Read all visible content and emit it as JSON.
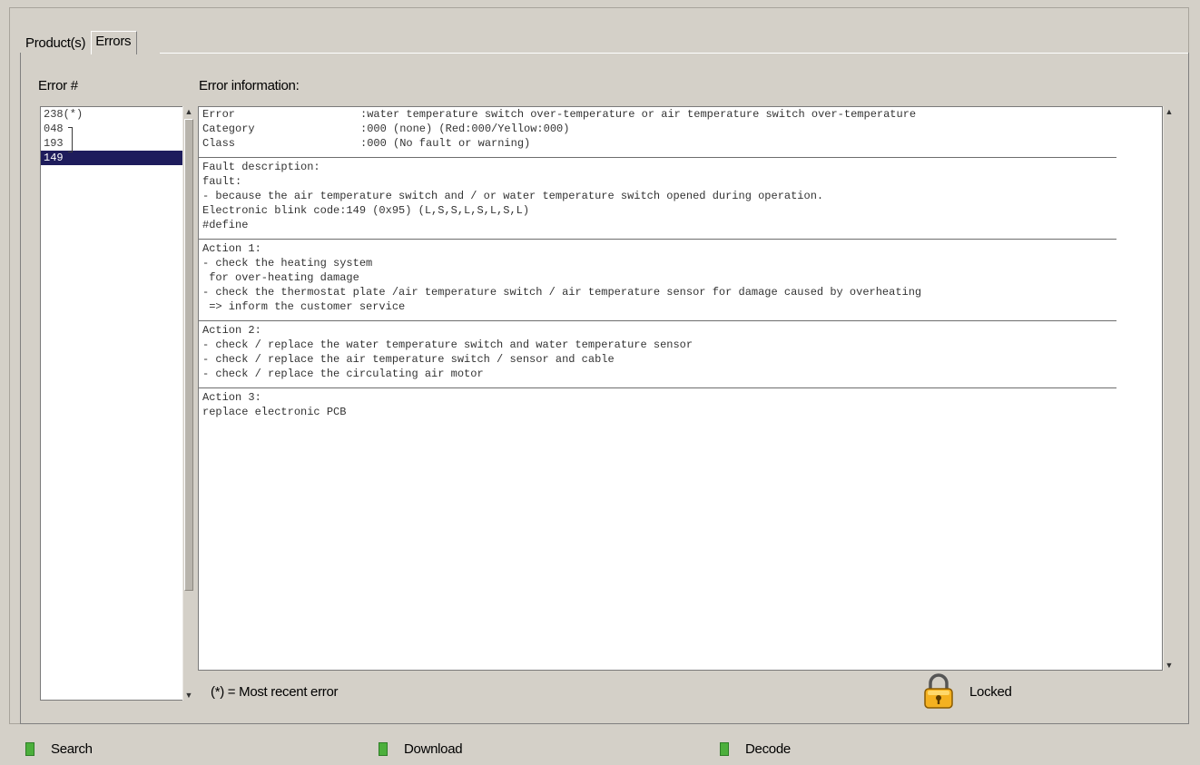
{
  "tabs": [
    {
      "label": "Product(s)",
      "active": false
    },
    {
      "label": "Errors",
      "active": true
    }
  ],
  "error_list": {
    "header": "Error #",
    "items": [
      {
        "code": "238(*)",
        "selected": false
      },
      {
        "code": "048",
        "selected": false
      },
      {
        "code": "193",
        "selected": false
      },
      {
        "code": "149",
        "selected": true
      }
    ]
  },
  "error_info": {
    "header": "Error information:",
    "fields": [
      {
        "key": "Error",
        "value": ":water temperature switch over-temperature or air temperature switch over-temperature"
      },
      {
        "key": "Category",
        "value": ":000 (none) (Red:000/Yellow:000)"
      },
      {
        "key": "Class",
        "value": ":000 (No fault or warning)"
      }
    ],
    "sections": [
      {
        "lines": [
          "Fault description:",
          "fault:",
          "- because the air temperature switch and / or water temperature switch opened during operation.",
          "Electronic blink code:149 (0x95) (L,S,S,L,S,L,S,L)",
          "#define"
        ]
      },
      {
        "lines": [
          "Action 1:",
          "- check the heating system",
          " for over-heating damage",
          "- check the thermostat plate /air temperature switch / air temperature sensor for damage caused by overheating",
          " => inform the customer service"
        ]
      },
      {
        "lines": [
          "Action 2:",
          "- check / replace the water temperature switch and water temperature sensor",
          "- check / replace the air temperature switch / sensor and cable",
          "- check / replace the circulating air motor"
        ]
      },
      {
        "lines": [
          "Action 3:",
          "replace electronic PCB"
        ]
      }
    ]
  },
  "footer": {
    "note": "(*) = Most recent error",
    "lock_status": "Locked",
    "lock_icon": "padlock-icon"
  },
  "actions": [
    {
      "label": "Search",
      "indicator_color": "#4caf3c"
    },
    {
      "label": "Download",
      "indicator_color": "#4caf3c"
    },
    {
      "label": "Decode",
      "indicator_color": "#4caf3c"
    }
  ]
}
